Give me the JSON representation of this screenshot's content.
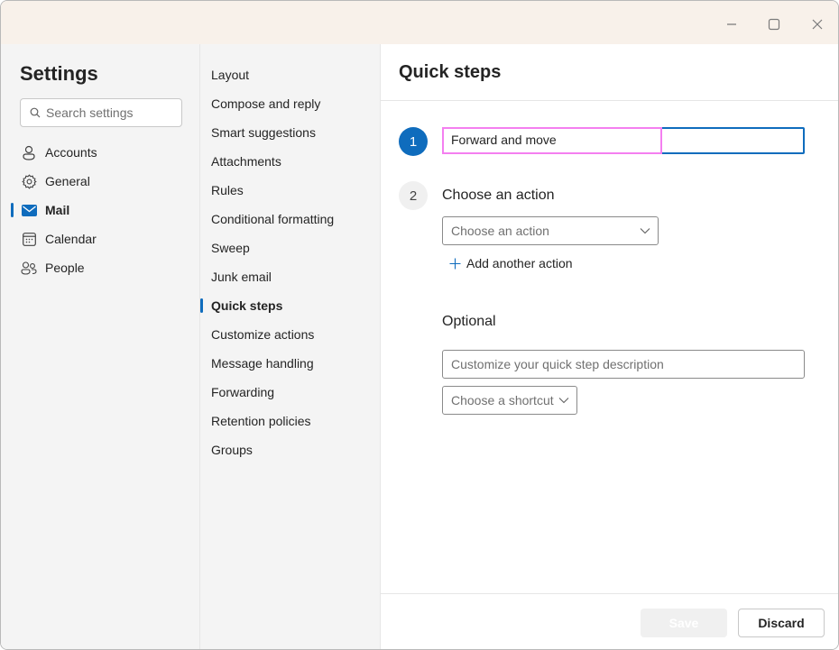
{
  "window": {
    "controls": {
      "minimize": "minimize",
      "maximize": "maximize",
      "close": "close"
    }
  },
  "nav1": {
    "title": "Settings",
    "search_placeholder": "Search settings",
    "items": [
      {
        "label": "Accounts",
        "icon": "person-icon",
        "active": false
      },
      {
        "label": "General",
        "icon": "gear-icon",
        "active": false
      },
      {
        "label": "Mail",
        "icon": "mail-icon",
        "active": true
      },
      {
        "label": "Calendar",
        "icon": "calendar-icon",
        "active": false
      },
      {
        "label": "People",
        "icon": "people-icon",
        "active": false
      }
    ]
  },
  "nav2": {
    "items": [
      {
        "label": "Layout"
      },
      {
        "label": "Compose and reply"
      },
      {
        "label": "Smart suggestions"
      },
      {
        "label": "Attachments"
      },
      {
        "label": "Rules"
      },
      {
        "label": "Conditional formatting"
      },
      {
        "label": "Sweep"
      },
      {
        "label": "Junk email"
      },
      {
        "label": "Quick steps",
        "active": true
      },
      {
        "label": "Customize actions"
      },
      {
        "label": "Message handling"
      },
      {
        "label": "Forwarding"
      },
      {
        "label": "Retention policies"
      },
      {
        "label": "Groups"
      }
    ]
  },
  "main": {
    "title": "Quick steps",
    "step1": {
      "number": "1",
      "name_value": "Forward and move"
    },
    "step2": {
      "number": "2",
      "label": "Choose an action",
      "dropdown_placeholder": "Choose an action",
      "add_action_label": "Add another action"
    },
    "optional": {
      "label": "Optional",
      "description_placeholder": "Customize your quick step description",
      "shortcut_placeholder": "Choose a shortcut"
    },
    "footer": {
      "save_label": "Save",
      "discard_label": "Discard"
    }
  },
  "colors": {
    "accent": "#0f6cbd",
    "highlight": "#f47ff0",
    "titlebar": "#f8f1ea"
  }
}
